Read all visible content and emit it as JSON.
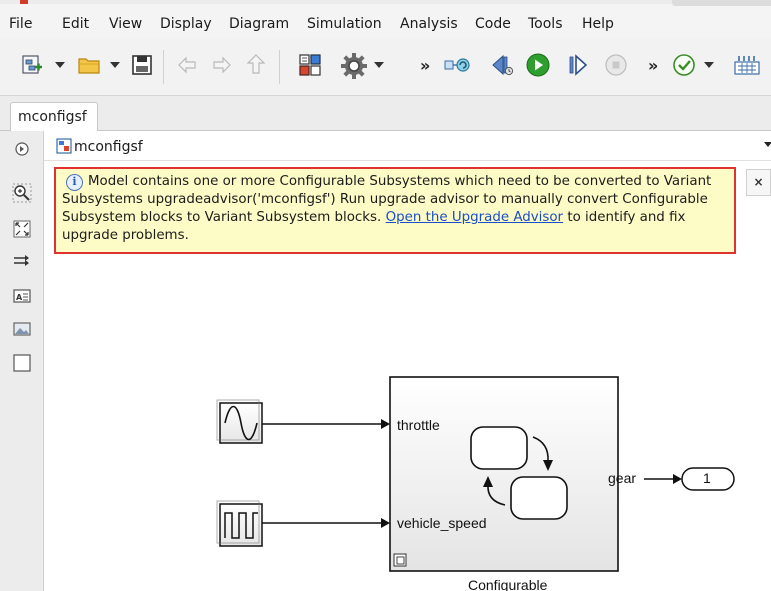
{
  "menu": {
    "items": [
      "File",
      "Edit",
      "View",
      "Display",
      "Diagram",
      "Simulation",
      "Analysis",
      "Code",
      "Tools",
      "Help"
    ]
  },
  "toolbar": {
    "icons": [
      "new-model-icon",
      "open-folder-icon",
      "save-icon",
      "back-arrow-icon",
      "forward-arrow-icon",
      "up-arrow-icon",
      "library-browser-icon",
      "model-settings-gear-icon",
      "refresh-model-icon",
      "step-back-icon",
      "run-icon",
      "step-forward-icon",
      "stop-icon",
      "check-icon",
      "data-display-icon"
    ],
    "overflow": "»"
  },
  "tab": {
    "label": "mconfigsf"
  },
  "breadcrumb": {
    "label": "mconfigsf"
  },
  "banner": {
    "message": "Model contains one or more Configurable Subsystems which need to be converted to Variant Subsystems upgradeadvisor('mconfigsf') Run upgrade advisor to manually convert Configurable Subsystem blocks to Variant Subsystem blocks.",
    "link_text": "Open the Upgrade Advisor",
    "message_tail": "to identify and fix upgrade problems.",
    "close": "×"
  },
  "diagram": {
    "input_port_1": "throttle",
    "input_port_2": "vehicle_speed",
    "output_port": "gear",
    "outport_number": "1",
    "subsystem_name": "Configurable"
  },
  "colors": {
    "banner_bg": "#fdfbc6",
    "banner_border": "#e0322f",
    "link": "#1a4ec9",
    "run_green": "#2e9e2e"
  }
}
